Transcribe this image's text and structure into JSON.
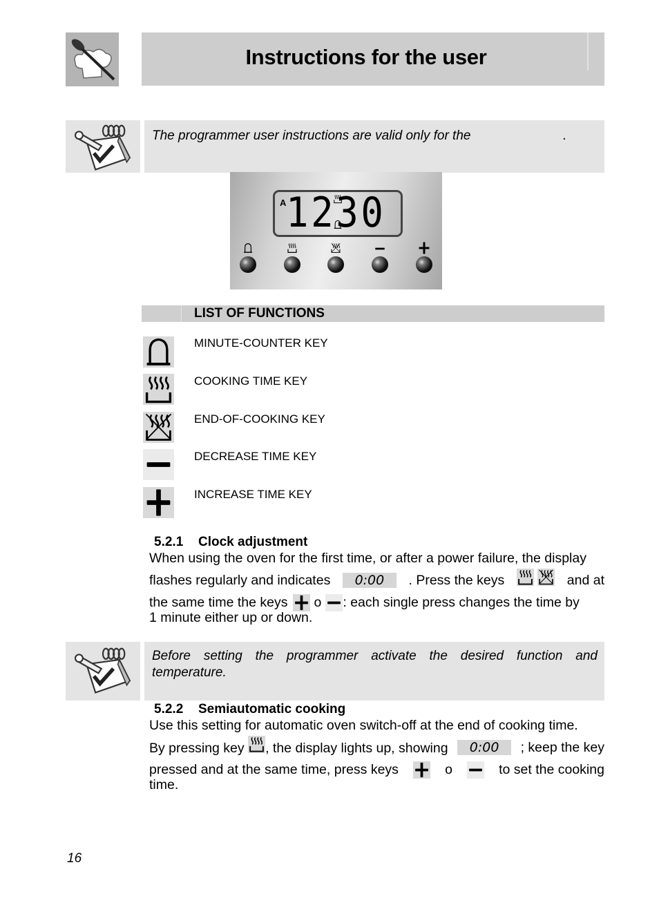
{
  "header": {
    "title": "Instructions for the user",
    "logo_icon": "chef-hat-spoon-icon"
  },
  "note_1": {
    "icon": "notepad-check-icon",
    "text": "The programmer user instructions are valid only for the",
    "trailing": "."
  },
  "panel": {
    "display": {
      "mode_indicator": "A",
      "time": "12:30",
      "digits": "1230",
      "indicators": [
        "cooking-time-icon",
        "bell-icon"
      ]
    },
    "keys": [
      {
        "icon": "bell-icon",
        "name": "minute-counter"
      },
      {
        "icon": "cooking-time-icon",
        "name": "cooking-time"
      },
      {
        "icon": "end-of-cooking-icon",
        "name": "end-of-cooking"
      },
      {
        "icon": "minus-icon",
        "name": "decrease"
      },
      {
        "icon": "plus-icon",
        "name": "increase"
      }
    ]
  },
  "functions": {
    "title": "LIST OF FUNCTIONS",
    "items": [
      {
        "icon": "bell-icon",
        "label": "MINUTE-COUNTER KEY"
      },
      {
        "icon": "cooking-time-icon",
        "label": "COOKING TIME KEY"
      },
      {
        "icon": "end-of-cooking-icon",
        "label": "END-OF-COOKING KEY"
      },
      {
        "icon": "minus-icon",
        "label": "DECREASE TIME KEY"
      },
      {
        "icon": "plus-icon",
        "label": "INCREASE TIME KEY"
      }
    ]
  },
  "section_521": {
    "number": "5.2.1",
    "title": "Clock adjustment",
    "line1": "When using the oven for the first time, or after a power failure, the display",
    "p1": "flashes regularly and indicates",
    "display_value": "0:00",
    "p2": ". Press the keys",
    "p3": "and at",
    "p4": "the same time the keys",
    "or_word": "o",
    "p5": ": each single press changes the time by",
    "p6": "1 minute either up or down."
  },
  "note_2": {
    "icon": "notepad-check-icon",
    "text": "Before setting the programmer activate the desired function and temperature."
  },
  "section_522": {
    "number": "5.2.2",
    "title": "Semiautomatic cooking",
    "line1": "Use this setting for automatic oven switch-off at the end of cooking time.",
    "p1": "By pressing key",
    "p2": ", the display lights up, showing",
    "display_value": "0:00",
    "p3": "; keep the key",
    "p4": "pressed and at the same time, press keys",
    "or_word": "o",
    "p5": "to set the cooking",
    "p6": "time."
  },
  "footer": {
    "page_number": "16"
  }
}
